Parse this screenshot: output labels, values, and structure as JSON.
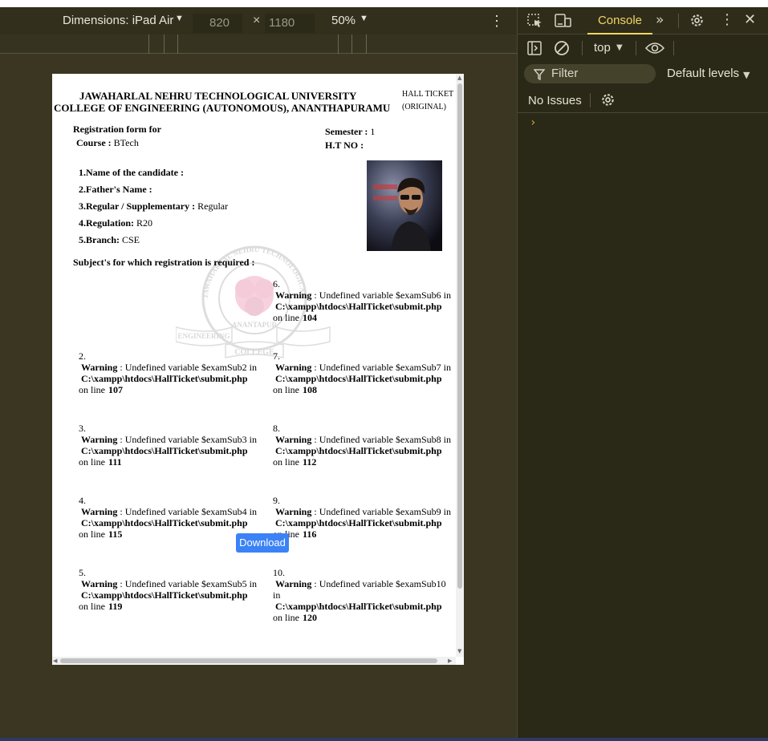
{
  "device_toolbar": {
    "dimensions_label": "Dimensions: iPad Air",
    "width_value": "820",
    "height_value": "1180",
    "times": "×",
    "zoom": "50%"
  },
  "document": {
    "university_line1": "JAWAHARLAL NEHRU TECHNOLOGICAL UNIVERSITY",
    "university_line2": "COLLEGE OF ENGINEERING (AUTONOMOUS), ANANTHAPURAMU",
    "hall_ticket_line1": "HALL TICKET",
    "hall_ticket_line2": "(ORIGINAL)",
    "registration_form_for": "Registration form for",
    "course_label": "Course :",
    "course_value": "BTech",
    "semester_label": "Semester :",
    "semester_value": "1",
    "htno_label": "H.T NO :",
    "fields": [
      {
        "label": "1.Name of the candidate :",
        "value": ""
      },
      {
        "label": "2.Father's Name :",
        "value": ""
      },
      {
        "label": "3.Regular / Supplementary :",
        "value": "Regular"
      },
      {
        "label": "4.Regulation:",
        "value": "R20"
      },
      {
        "label": "5.Branch:",
        "value": "CSE"
      }
    ],
    "subjects_title": "Subject's for which registration is required :",
    "warnings": [
      {
        "num": "2.",
        "text": ": Undefined variable $examSub2 in",
        "line": "107"
      },
      {
        "num": "3.",
        "text": ": Undefined variable $examSub3 in",
        "line": "111"
      },
      {
        "num": "4.",
        "text": ": Undefined variable $examSub4 in",
        "line": "115"
      },
      {
        "num": "5.",
        "text": ": Undefined variable $examSub5 in",
        "line": "119"
      },
      {
        "num": "6.",
        "text": ": Undefined variable $examSub6 in",
        "line": "104"
      },
      {
        "num": "7.",
        "text": ": Undefined variable $examSub7 in",
        "line": "108"
      },
      {
        "num": "8.",
        "text": ": Undefined variable $examSub8 in",
        "line": "112"
      },
      {
        "num": "9.",
        "text": ": Undefined variable $examSub9 in",
        "line": "116"
      },
      {
        "num": "10.",
        "text": ": Undefined variable $examSub10 in",
        "line": "120"
      }
    ],
    "warning_label": "Warning",
    "warning_path": "C:\\xampp\\htdocs\\HallTicket\\submit.php",
    "on_line_label": "on line",
    "watermark_text": "JAWAHARLAL NEHRU TECHNOLOGICAL UNIVERSITY",
    "watermark_city": "ANANTAPUR",
    "watermark_left": "ENGINEERING",
    "watermark_bottom": "COLLEGE",
    "download_label": "Download"
  },
  "devtools": {
    "console_tab": "Console",
    "context": "top",
    "filter_placeholder": "Filter",
    "levels": "Default levels",
    "no_issues": "No Issues",
    "prompt": "›"
  },
  "colors": {
    "accent": "#f0d664",
    "download_button": "#3b82f6",
    "background": "#3a3621"
  },
  "icons": [
    "inspect-icon",
    "device-toggle-icon",
    "more-tabs-icon",
    "settings-icon",
    "kebab-icon",
    "close-icon",
    "sidebar-icon",
    "clear-icon",
    "eye-icon",
    "filter-icon",
    "issues-settings-icon"
  ]
}
